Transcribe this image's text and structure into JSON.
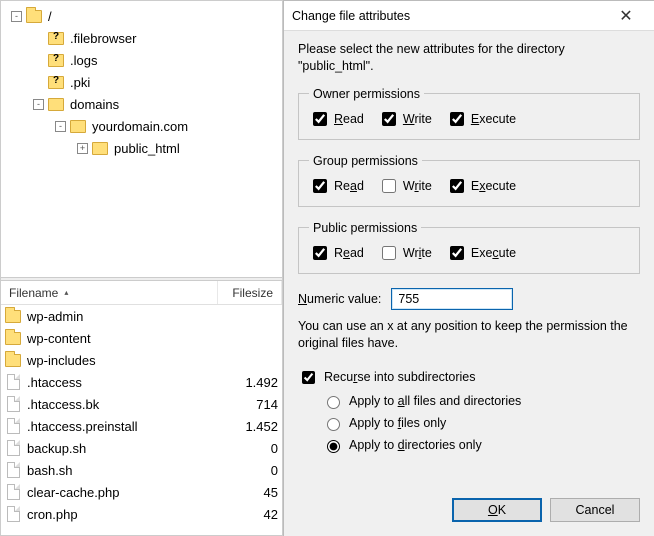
{
  "tree": {
    "root": {
      "label": "/",
      "expanded": true
    },
    "items": [
      {
        "label": ".filebrowser",
        "unknown": true,
        "indent": 1
      },
      {
        "label": ".logs",
        "unknown": true,
        "indent": 1
      },
      {
        "label": ".pki",
        "unknown": true,
        "indent": 1
      },
      {
        "label": "domains",
        "unknown": false,
        "indent": 1,
        "expander": "-"
      },
      {
        "label": "yourdomain.com",
        "unknown": false,
        "indent": 2,
        "expander": "-"
      },
      {
        "label": "public_html",
        "unknown": false,
        "indent": 3,
        "expander": "+"
      }
    ]
  },
  "list": {
    "header_name": "Filename",
    "header_size": "Filesize",
    "rows": [
      {
        "name": "wp-admin",
        "size": "",
        "type": "folder"
      },
      {
        "name": "wp-content",
        "size": "",
        "type": "folder"
      },
      {
        "name": "wp-includes",
        "size": "",
        "type": "folder"
      },
      {
        "name": ".htaccess",
        "size": "1.492",
        "type": "file"
      },
      {
        "name": ".htaccess.bk",
        "size": "714",
        "type": "file"
      },
      {
        "name": ".htaccess.preinstall",
        "size": "1.452",
        "type": "file"
      },
      {
        "name": "backup.sh",
        "size": "0",
        "type": "file"
      },
      {
        "name": "bash.sh",
        "size": "0",
        "type": "file"
      },
      {
        "name": "clear-cache.php",
        "size": "45",
        "type": "file"
      },
      {
        "name": "cron.php",
        "size": "42",
        "type": "file"
      }
    ]
  },
  "dialog": {
    "title": "Change file attributes",
    "instruction_pre": "Please select the new attributes for the directory ",
    "instruction_target": "\"public_html\".",
    "owner_legend": "Owner permissions",
    "group_legend": "Group permissions",
    "public_legend": "Public permissions",
    "read_label_pre": "R",
    "read_label_post": "ead",
    "write_label_pre": "W",
    "write_label_post": "rite",
    "execute_label_pre": "E",
    "execute_label_post": "xecute",
    "numeric_label_pre": "N",
    "numeric_label_post": "umeric value:",
    "numeric_value": "755",
    "hint": "You can use an x at any position to keep the permission the original files have.",
    "recurse_label_pre": "Recu",
    "recurse_label_u": "r",
    "recurse_label_post": "se into subdirectories",
    "opt_all_pre": "Apply to ",
    "opt_all_u": "a",
    "opt_all_post": "ll files and directories",
    "opt_files_pre": "Apply to ",
    "opt_files_u": "f",
    "opt_files_post": "iles only",
    "opt_dirs_pre": "Apply to ",
    "opt_dirs_u": "d",
    "opt_dirs_post": "irectories only",
    "ok_label_pre": "O",
    "ok_label_u": "K",
    "cancel_label": "Cancel",
    "owner": {
      "read": true,
      "write": true,
      "execute": true
    },
    "group": {
      "read": true,
      "write": false,
      "execute": true
    },
    "public": {
      "read": true,
      "write": false,
      "execute": true
    },
    "recurse_checked": true,
    "recurse_mode": "dirs"
  }
}
